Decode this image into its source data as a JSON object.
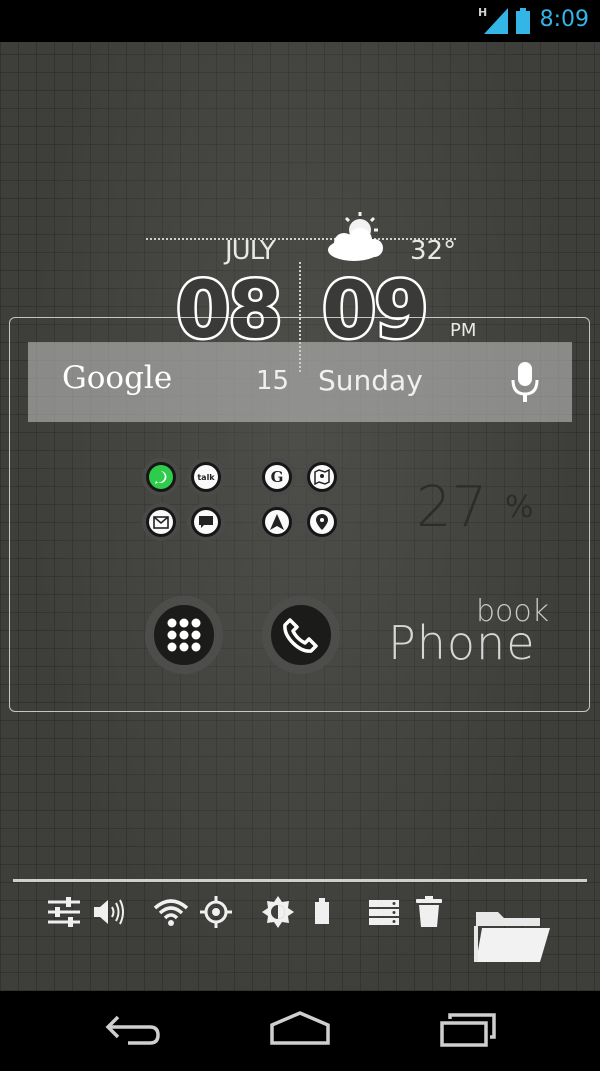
{
  "status_bar": {
    "network": "H",
    "time": "8:09",
    "accent": "#33b5e5"
  },
  "clock_widget": {
    "month": "JULY",
    "temperature": "32°",
    "weather_icon": "partly-cloudy-icon",
    "hour": "08",
    "minute": "09",
    "ampm": "PM"
  },
  "search_bar": {
    "google_label": "Google",
    "day_number": "15",
    "day_name": "Sunday",
    "mic_icon": "microphone-icon"
  },
  "app_grid": {
    "left": [
      "whatsapp-icon",
      "talk-icon",
      "email-icon",
      "messaging-icon"
    ],
    "right": [
      "google-search-icon",
      "maps-icon",
      "navigation-icon",
      "places-icon"
    ],
    "talk_label": "talk",
    "google_label": "G"
  },
  "battery_widget": {
    "value": "27",
    "unit": "%"
  },
  "launcher": {
    "app_drawer_icon": "app-drawer-icon",
    "phone_icon": "phone-icon",
    "book_label": "book",
    "phone_label": "Phone"
  },
  "dock": {
    "icons": [
      "settings-sliders-icon",
      "volume-icon",
      "wifi-icon",
      "gps-icon",
      "brightness-icon",
      "battery-icon",
      "storage-icon",
      "trash-icon",
      "folder-icon"
    ]
  },
  "nav_bar": {
    "icons": [
      "back-icon",
      "home-icon",
      "recent-apps-icon"
    ]
  }
}
